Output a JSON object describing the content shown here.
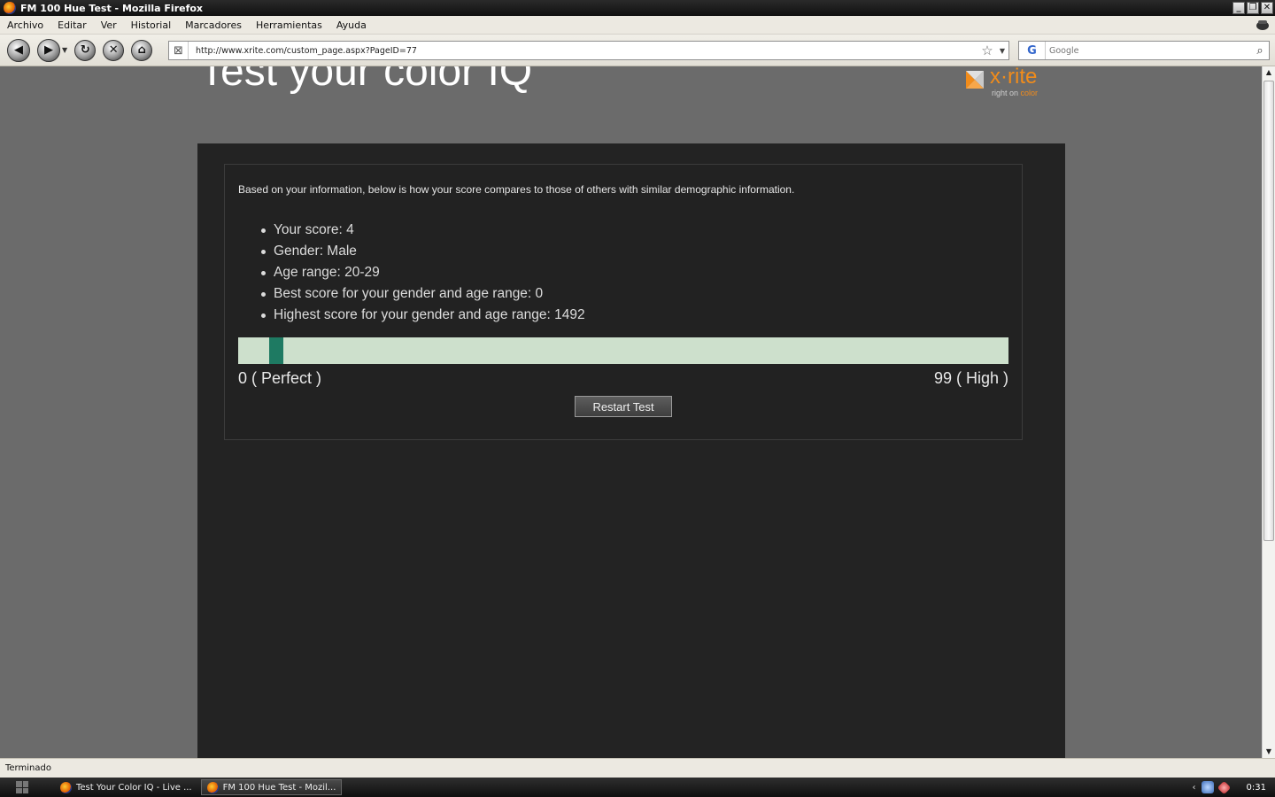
{
  "window": {
    "title": "FM 100 Hue Test - Mozilla Firefox",
    "buttons": {
      "minimize": "_",
      "restore": "❐",
      "close": "✕"
    }
  },
  "menu": {
    "items": [
      "Archivo",
      "Editar",
      "Ver",
      "Historial",
      "Marcadores",
      "Herramientas",
      "Ayuda"
    ]
  },
  "navbar": {
    "url": "http://www.xrite.com/custom_page.aspx?PageID=77",
    "search_placeholder": "Google",
    "search_engine": "G"
  },
  "page": {
    "heading": "Test your color IQ",
    "logo": {
      "word": "x·rite",
      "tagline_prefix": "right on ",
      "tagline_accent": "color",
      "accent_color": "#f28c1a"
    },
    "intro": "Based on your information, below is how your score compares to those of others with similar demographic information.",
    "stats": [
      "Your score: 4",
      "Gender: Male",
      "Age range: 20-29",
      "Best score for your gender and age range: 0",
      "Highest score for your gender and age range: 1492"
    ],
    "score_scale": {
      "min_label": "0 ( Perfect )",
      "max_label": "99 ( High )",
      "min": 0,
      "max": 99,
      "score": 4
    },
    "restart_label": "Restart Test",
    "colors": {
      "bar": "#cde0cc",
      "marker": "#1e7a62",
      "panel": "#232323",
      "background": "#6b6b6b"
    }
  },
  "status": {
    "text": "Terminado"
  },
  "taskbar": {
    "tasks": [
      {
        "label": "Test Your Color IQ - Live ...",
        "active": false
      },
      {
        "label": "FM 100 Hue Test - Mozil...",
        "active": true
      }
    ],
    "clock": "0:31"
  }
}
